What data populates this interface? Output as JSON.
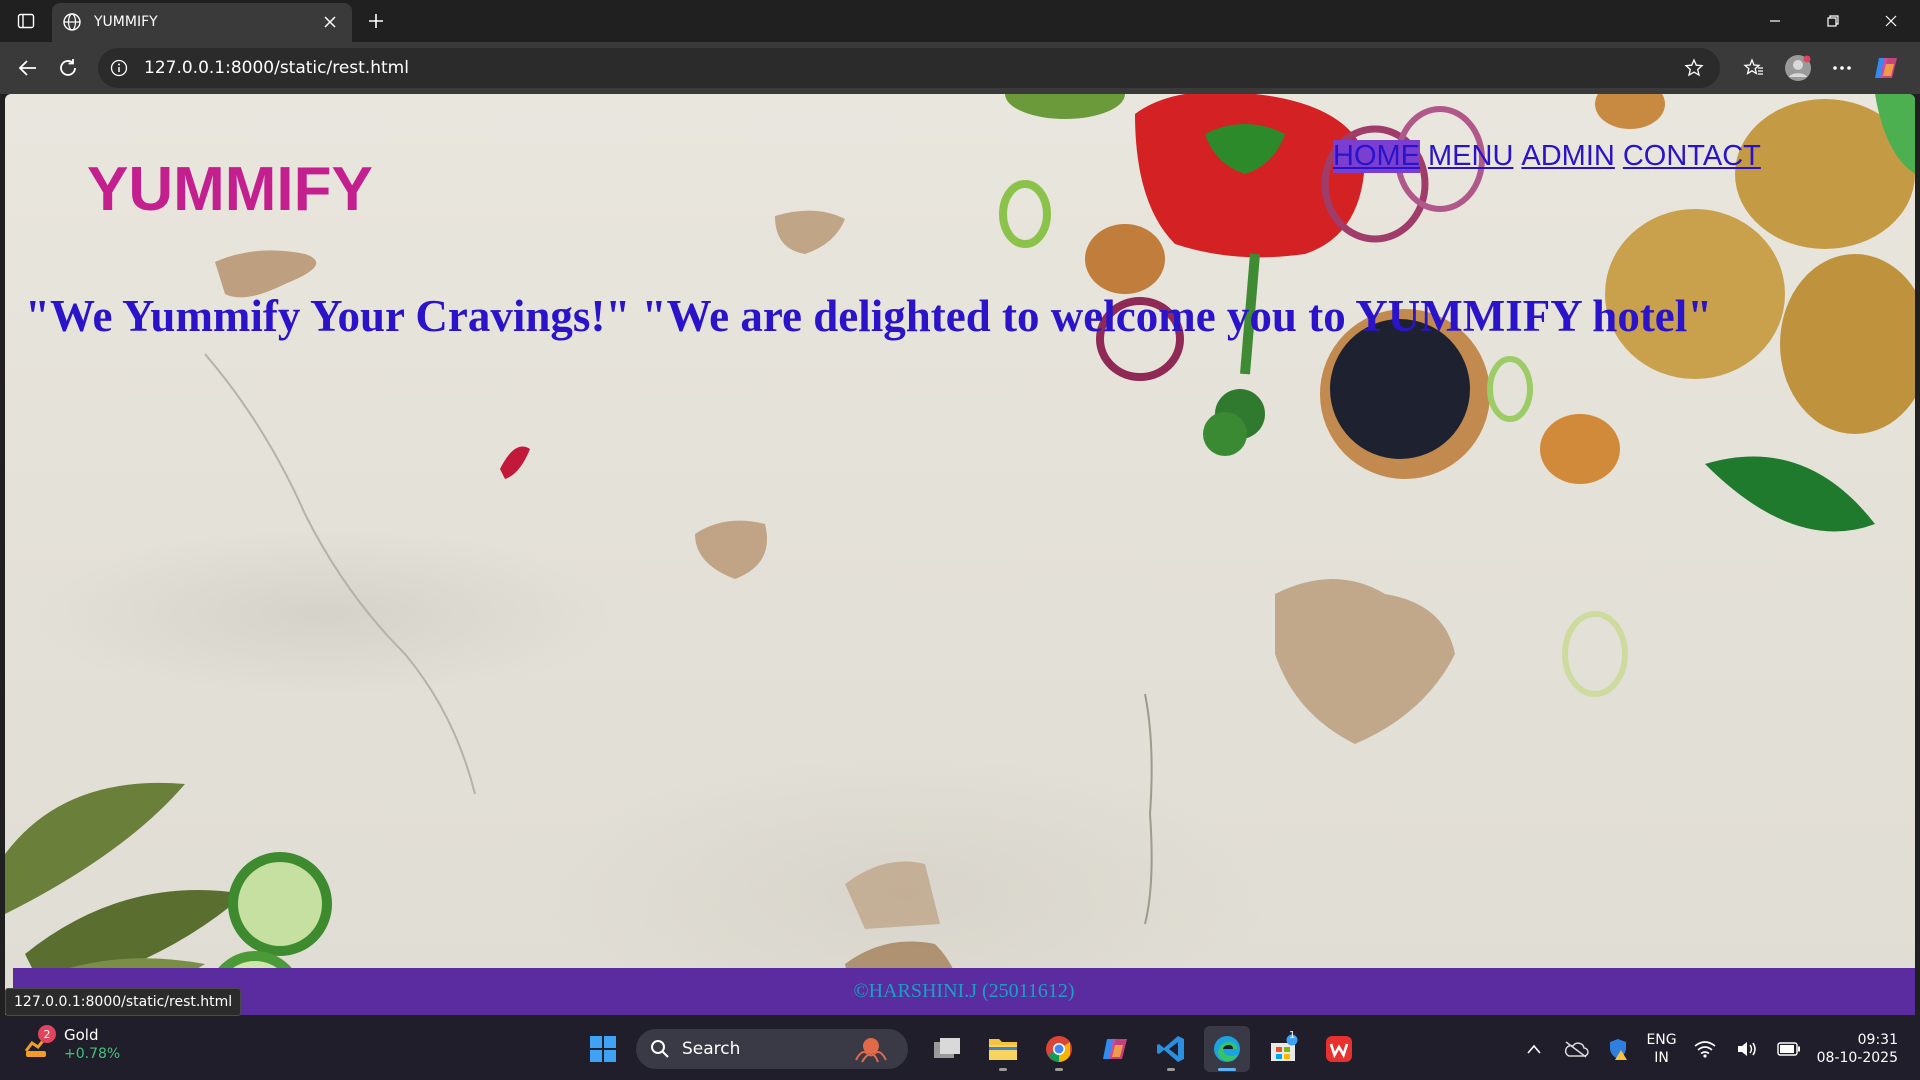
{
  "browser": {
    "tab_title": "YUMMIFY",
    "url": "127.0.0.1:8000/static/rest.html",
    "status_url": "127.0.0.1:8000/static/rest.html"
  },
  "page": {
    "logo": "YUMMIFY",
    "nav": [
      {
        "label": "HOME",
        "active": true
      },
      {
        "label": "MENU",
        "active": false
      },
      {
        "label": "ADMIN",
        "active": false
      },
      {
        "label": "CONTACT",
        "active": false
      }
    ],
    "tagline": "\"We Yummify Your Cravings!\" \"We are delighted to welcome you to YUMMIFY hotel\"",
    "footer": "©HARSHINI.J (25011612)",
    "colors": {
      "logo": "#c41f8f",
      "link": "#2b13c9",
      "footer_bg": "#5b2ca0",
      "footer_text": "#19a0c6"
    }
  },
  "taskbar": {
    "widget": {
      "badge": "2",
      "name": "Gold",
      "change": "+0.78%"
    },
    "search_placeholder": "Search",
    "language": {
      "line1": "ENG",
      "line2": "IN"
    },
    "time": "09:31",
    "date": "08-10-2025",
    "store_badge": "1"
  }
}
